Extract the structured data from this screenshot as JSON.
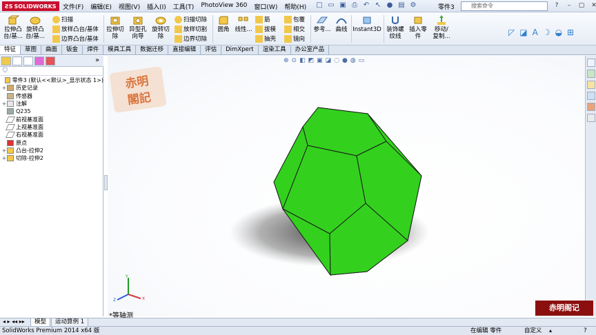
{
  "app": {
    "logo_text": "SOLIDWORKS",
    "document_title": "零件3",
    "search_placeholder": "搜索命令"
  },
  "menu": [
    "文件(F)",
    "编辑(E)",
    "视图(V)",
    "插入(I)",
    "工具(T)",
    "PhotoView 360",
    "窗口(W)",
    "帮助(H)"
  ],
  "ribbon": {
    "extrude_boss": "拉伸凸\n台/基...",
    "revolve_boss": "旋转凸\n台/基...",
    "sweep": "扫描",
    "loft_boss": "放样凸台/基体",
    "boundary_boss": "边界凸台/基体",
    "extrude_cut": "拉伸切\n除",
    "hole_wizard": "异型孔\n向导",
    "revolve_cut": "旋转切\n除",
    "swept_cut": "扫描切除",
    "lofted_cut": "放样切割",
    "boundary_cut": "边界切除",
    "fillet": "圆角",
    "linear_pattern": "线性...",
    "rib": "筋",
    "draft": "拔模",
    "shell": "抽壳",
    "wrap": "包覆",
    "intersect": "相交",
    "mirror": "镜向",
    "reference": "参考...",
    "curves": "曲线",
    "instant3d": "Instant3D",
    "thread": "装饰螺\n纹线",
    "insert_part": "插入零\n件",
    "move_copy": "移动/\n复制..."
  },
  "tabs": [
    "特征",
    "草图",
    "曲面",
    "钣金",
    "焊件",
    "模具工具",
    "数据迁移",
    "直接编辑",
    "评估",
    "DimXpert",
    "渲染工具",
    "办公室产品"
  ],
  "active_tab": "特征",
  "tree": [
    {
      "label": "零件3 (默认<<默认>_显示状态 1>)",
      "icon": "part-icon",
      "toggle": ""
    },
    {
      "label": "历史记录",
      "icon": "history-icon",
      "toggle": "+"
    },
    {
      "label": "传感器",
      "icon": "sensor-icon",
      "toggle": ""
    },
    {
      "label": "注解",
      "icon": "annotation-icon",
      "toggle": "+"
    },
    {
      "label": "Q235",
      "icon": "material-icon",
      "toggle": ""
    },
    {
      "label": "前视基准面",
      "icon": "plane-icon",
      "toggle": ""
    },
    {
      "label": "上视基准面",
      "icon": "plane-icon",
      "toggle": ""
    },
    {
      "label": "右视基准面",
      "icon": "plane-icon",
      "toggle": ""
    },
    {
      "label": "原点",
      "icon": "origin-icon",
      "toggle": ""
    },
    {
      "label": "凸台-拉伸2",
      "icon": "extrude-feature-icon",
      "toggle": "+"
    },
    {
      "label": "切除-拉伸2",
      "icon": "cut-feature-icon",
      "toggle": "+"
    }
  ],
  "viewport": {
    "view_name": "*等轴测",
    "model_color": "#33d11e"
  },
  "bottom_tabs": [
    "模型",
    "运动算例 1"
  ],
  "status": {
    "product": "SolidWorks Premium 2014 x64 版",
    "mode": "在编辑 零件",
    "custom": "自定义"
  },
  "watermark": {
    "text": "赤明阁记"
  }
}
